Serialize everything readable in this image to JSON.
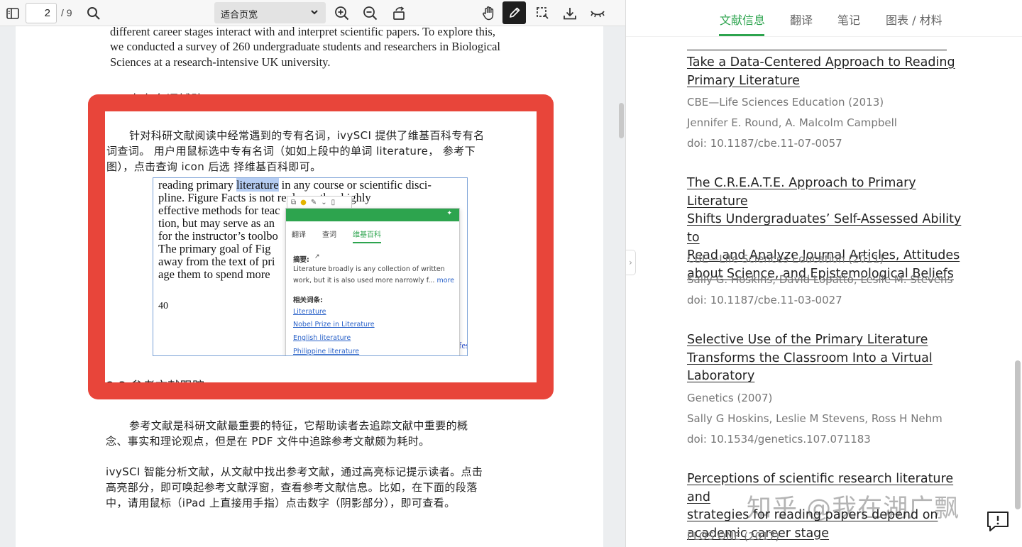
{
  "toolbar": {
    "page_current": "2",
    "page_total": "/ 9",
    "zoom_value": "适合页宽"
  },
  "pdf": {
    "intro_lines": [
      "different career stages interact with and interpret scientific papers. To explore this,",
      "we conducted a survey of 260 undergraduate students and researchers in Biological",
      "Sciences at a research-intensive UK university."
    ],
    "section_heading_partial": "2.2  专有名词辅助",
    "feature_para": [
      "针对科研文献阅读中经常遇到的专有名词，ivySCI 提供了维基百科专有名",
      "词查词。 用户用鼠标选中专有名词（如如上段中的单词  literature，  参考下",
      "图），点击查询  icon 后选 择维基百科即可。"
    ],
    "screenshot": {
      "line1_before": "reading primary ",
      "line1_highlight": "literature",
      "line1_after": " in any course or scientific disci-",
      "lines": [
        "pline. Figure Facts is not                    replace other highly",
        "effective methods for teac",
        "tion, but may serve as an",
        "for the instructor’s toolbo",
        "   The primary goal of Fig",
        "away from the text of pri",
        "age them to spend more"
      ],
      "page_number": "40",
      "edge_fragment": "fes"
    },
    "popup": {
      "tabs": [
        "翻译",
        "查词",
        "维基百科"
      ],
      "summary_label": "摘要:",
      "summary_line1": "Literature broadly is any collection of written",
      "summary_line2": "work, but it is also used more narrowly f...",
      "more": "more",
      "related_label": "相关词条:",
      "related": [
        "Literature",
        "Nobel Prize in Literature",
        "English literature",
        "Philippine literature"
      ]
    },
    "next_heading_partial": "2.3  参考文献跟踪",
    "ref_para": [
      "参考文献是科研文献最重要的特征，它帮助读者去追踪文献中重要的概",
      "念、事实和理论观点，但是在 PDF 文件中追踪参考文献颇为耗时。"
    ],
    "ivy_para": [
      "ivySCI 智能分析文献，从文献中找出参考文献，通过高亮标记提示读者。点击",
      "高亮部分，即可唤起参考文献浮窗，查看参考文献信息。比如，在下面的段落",
      "中，请用鼠标（iPad  上直接用手指）点击数字（阴影部分），即可查看。"
    ]
  },
  "panel": {
    "tabs": [
      "文献信息",
      "翻译",
      "笔记",
      "图表 / 材料"
    ],
    "active_tab": 0,
    "references": [
      {
        "title_lines": [
          "Take a Data-Centered Approach to Reading",
          "Primary Literature"
        ],
        "journal": "CBE—Life Sciences Education (2013)",
        "authors": "Jennifer E. Round, A. Malcolm Campbell",
        "doi": "doi: 10.1187/cbe.11-07-0057"
      },
      {
        "title_lines": [
          "The C.R.E.A.T.E. Approach to Primary Literature",
          "Shifts Undergraduates’ Self-Assessed Ability to",
          "Read and Analyze Journal Articles, Attitudes",
          "about Science, and Epistemological Beliefs"
        ],
        "journal": "CBE—Life Sciences Education (2011)",
        "authors": "Sally G. Hoskins, David Lopatto, Leslie M. Stevens",
        "doi": "doi: 10.1187/cbe.11-03-0027"
      },
      {
        "title_lines": [
          "Selective Use of the Primary Literature",
          "Transforms the Classroom Into a Virtual",
          "Laboratory"
        ],
        "journal": "Genetics (2007)",
        "authors": "Sally G Hoskins, Leslie M Stevens, Ross H Nehm",
        "doi": "doi: 10.1534/genetics.107.071183"
      },
      {
        "title_lines": [
          "Perceptions of scientific research literature and",
          "strategies for reading papers depend on",
          "academic career stage"
        ],
        "journal": "PLOS ONE (2017)"
      }
    ],
    "watermark": "知乎 @我在湖广飘"
  },
  "colors": {
    "accent_green": "#2da44e",
    "highlight_red": "#e8453a"
  }
}
